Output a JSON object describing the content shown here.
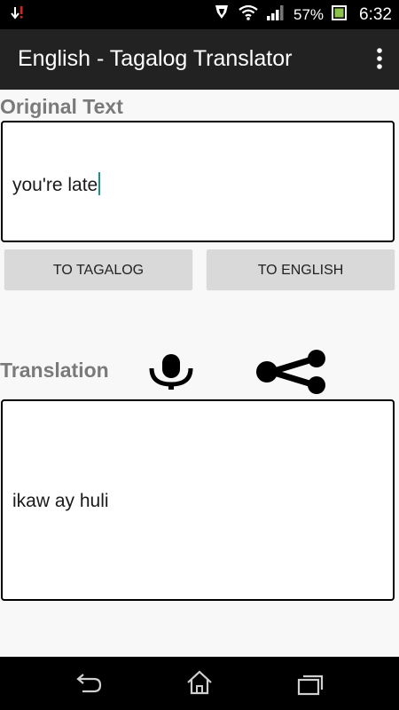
{
  "status_bar": {
    "battery_percent": "57%",
    "time": "6:32",
    "icons": [
      "download-icon",
      "nfc-icon",
      "wifi-icon",
      "signal-icon",
      "battery-icon"
    ]
  },
  "action_bar": {
    "title": "English - Tagalog Translator",
    "menu_icon": "overflow-menu-icon"
  },
  "original": {
    "label": "Original Text",
    "value": "you're late"
  },
  "buttons": {
    "to_tagalog": "TO TAGALOG",
    "to_english": "TO ENGLISH"
  },
  "translation": {
    "label": "Translation",
    "value": "ikaw ay huli",
    "mic_icon": "microphone-icon",
    "share_icon": "share-icon"
  },
  "nav_bar": {
    "icons": [
      "back-icon",
      "home-icon",
      "recent-apps-icon"
    ]
  },
  "colors": {
    "status_bar": "#000000",
    "action_bar": "#222222",
    "label_gray": "#7a7a7a",
    "caret": "#159588",
    "button": "#d9d9d9"
  }
}
